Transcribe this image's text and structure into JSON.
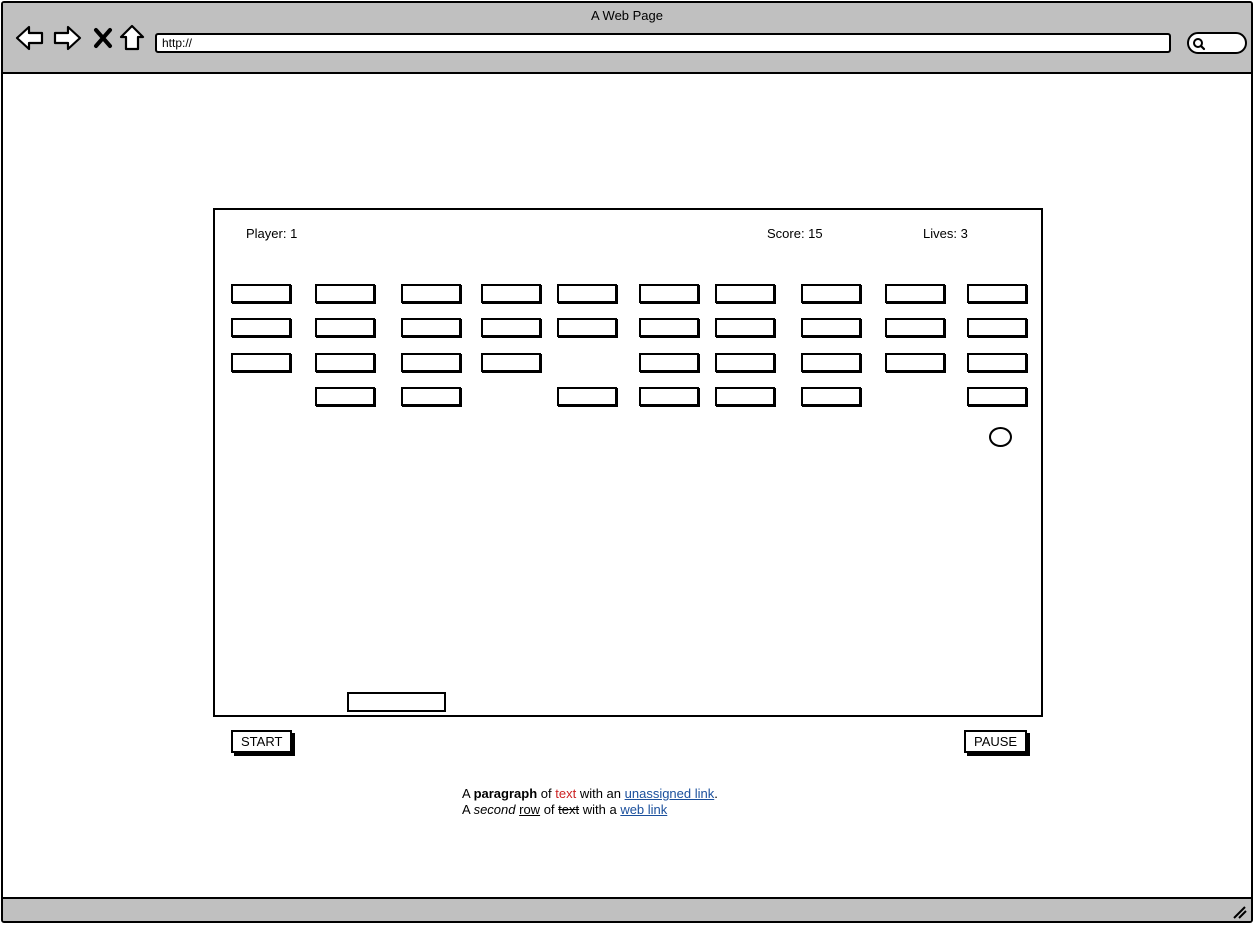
{
  "window": {
    "title": "A Web Page",
    "url": "http://"
  },
  "icons": {
    "back": "back-arrow-icon",
    "forward": "forward-arrow-icon",
    "stop": "close-icon",
    "home": "home-icon",
    "search": "search-icon"
  },
  "hud": {
    "player": "Player: 1",
    "score": "Score: 15",
    "lives": "Lives: 3"
  },
  "bricks": {
    "columns": 10,
    "rows": 4,
    "present": [
      [
        1,
        1,
        1,
        1,
        1,
        1,
        1,
        1,
        1,
        1
      ],
      [
        1,
        1,
        1,
        1,
        1,
        1,
        1,
        1,
        1,
        1
      ],
      [
        1,
        1,
        1,
        1,
        0,
        1,
        1,
        1,
        1,
        1
      ],
      [
        0,
        1,
        1,
        0,
        1,
        1,
        1,
        1,
        0,
        1
      ]
    ]
  },
  "controls": {
    "start_label": "START",
    "pause_label": "PAUSE"
  },
  "paragraph": {
    "line1": {
      "a": "A ",
      "bold": "paragraph",
      "of": " of ",
      "red": "text",
      "with": " with an ",
      "link": "unassigned link",
      "end": "."
    },
    "line2": {
      "a": "A ",
      "italic": "second",
      "space": " ",
      "underline": "row",
      "of": " of ",
      "strike": "text",
      "with": " with a ",
      "link": "web link"
    }
  },
  "colors": {
    "chrome": "#c0c0c0",
    "link": "#1a4f9c",
    "accent_text": "#cc2222"
  }
}
